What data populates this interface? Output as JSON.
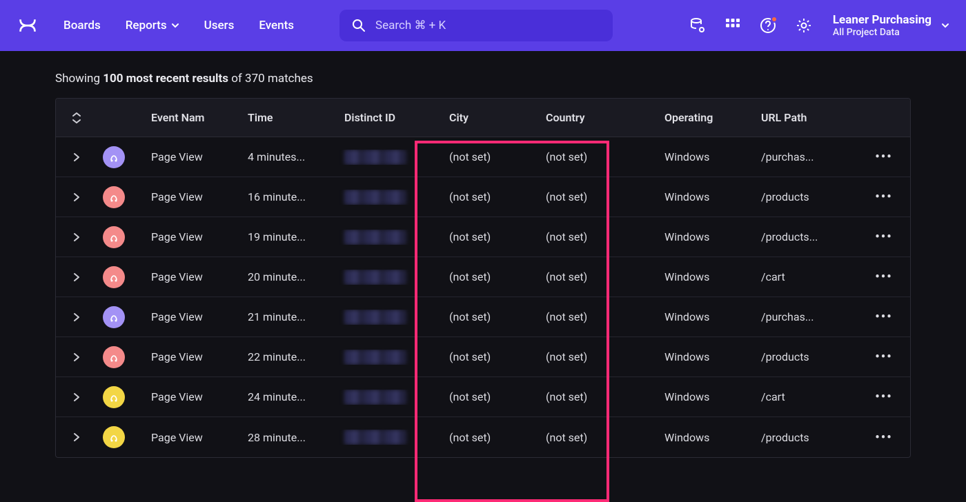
{
  "nav": {
    "boards": "Boards",
    "reports": "Reports",
    "users": "Users",
    "events": "Events"
  },
  "search": {
    "placeholder": "Search  ⌘ + K"
  },
  "project": {
    "title": "Leaner Purchasing",
    "subtitle": "All Project Data"
  },
  "summary": {
    "prefix": "Showing ",
    "bold": "100 most recent results",
    "suffix": " of 370 matches"
  },
  "columns": {
    "event_name": "Event Nam",
    "time": "Time",
    "distinct_id": "Distinct ID",
    "city": "City",
    "country": "Country",
    "operating": "Operating",
    "url_path": "URL Path"
  },
  "rows": [
    {
      "avatar": "purple",
      "event": "Page View",
      "time": "4 minutes...",
      "city": "(not set)",
      "country": "(not set)",
      "os": "Windows",
      "url": "/purchas..."
    },
    {
      "avatar": "pink",
      "event": "Page View",
      "time": "16 minute...",
      "city": "(not set)",
      "country": "(not set)",
      "os": "Windows",
      "url": "/products"
    },
    {
      "avatar": "pink",
      "event": "Page View",
      "time": "19 minute...",
      "city": "(not set)",
      "country": "(not set)",
      "os": "Windows",
      "url": "/products..."
    },
    {
      "avatar": "pink",
      "event": "Page View",
      "time": "20 minute...",
      "city": "(not set)",
      "country": "(not set)",
      "os": "Windows",
      "url": "/cart"
    },
    {
      "avatar": "purple",
      "event": "Page View",
      "time": "21 minute...",
      "city": "(not set)",
      "country": "(not set)",
      "os": "Windows",
      "url": "/purchas..."
    },
    {
      "avatar": "pink",
      "event": "Page View",
      "time": "22 minute...",
      "city": "(not set)",
      "country": "(not set)",
      "os": "Windows",
      "url": "/products"
    },
    {
      "avatar": "yellow",
      "event": "Page View",
      "time": "24 minute...",
      "city": "(not set)",
      "country": "(not set)",
      "os": "Windows",
      "url": "/cart"
    },
    {
      "avatar": "yellow",
      "event": "Page View",
      "time": "28 minute...",
      "city": "(not set)",
      "country": "(not set)",
      "os": "Windows",
      "url": "/products"
    }
  ]
}
